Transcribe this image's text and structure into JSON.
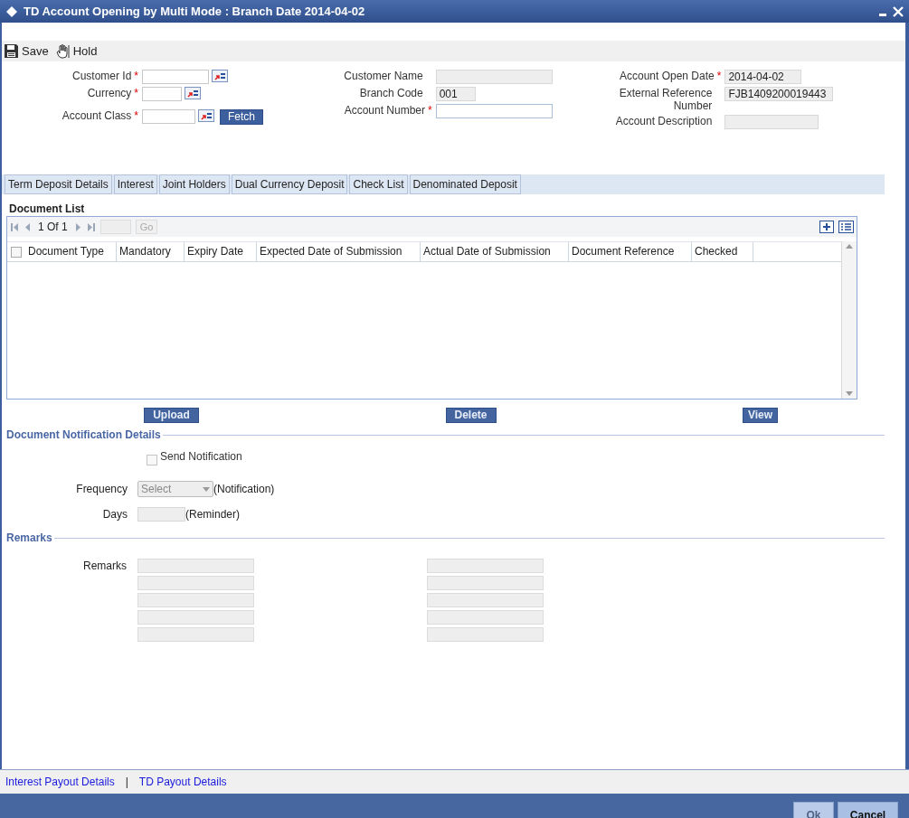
{
  "window": {
    "title": "TD Account Opening by Multi Mode : Branch Date 2014-04-02"
  },
  "toolbar": [
    {
      "kind": "save",
      "label": "Save"
    },
    {
      "kind": "hold",
      "label": "Hold"
    }
  ],
  "header_columns": [
    [
      {
        "label": "Customer Id",
        "required_mark": "*",
        "kind": "lov"
      },
      {
        "label": "Currency",
        "required_mark": "*",
        "kind": "lov"
      },
      {
        "label": "Account Class",
        "required_mark": "*",
        "kind": "lov",
        "action": "Fetch"
      }
    ],
    [
      {
        "label": "Customer Name",
        "kind": "readonly"
      },
      {
        "label": "Branch Code",
        "kind": "readonly",
        "value": "001"
      },
      {
        "label": "Account Number",
        "required_mark": "*",
        "kind": "text"
      }
    ],
    [
      {
        "label": "Account Open Date",
        "required_mark": "*",
        "kind": "readonly",
        "value": "2014-04-02"
      },
      {
        "label": "External Reference Number",
        "kind": "readonly",
        "value": "FJB1409200019443"
      },
      {
        "label": "Account Description",
        "kind": "readonly"
      }
    ]
  ],
  "tabs": [
    "Term Deposit Details",
    "Interest",
    "Joint Holders",
    "Dual Currency Deposit",
    "Check List",
    "Denominated Deposit"
  ],
  "document_list": {
    "title": "Document List",
    "pager": "1 Of 1",
    "go": "Go",
    "select_all_checked": false,
    "columns": [
      "Document Type",
      "Mandatory",
      "Expiry Date",
      "Expected Date of Submission",
      "Actual Date of Submission",
      "Document Reference",
      "Checked"
    ]
  },
  "list_buttons": [
    "Upload",
    "Delete",
    "View"
  ],
  "notification": {
    "title": "Document Notification Details",
    "send": {
      "label": "Send Notification",
      "checked": false,
      "disabled": true
    },
    "frequency": {
      "label": "Frequency",
      "placeholder": "Select",
      "suffix": "(Notification)"
    },
    "days": {
      "label": "Days",
      "suffix": "(Reminder)"
    }
  },
  "remarks": {
    "title": "Remarks",
    "label": "Remarks",
    "columns": [
      [
        {
          "kind": "readonly"
        },
        {
          "kind": "readonly"
        },
        {
          "kind": "readonly"
        },
        {
          "kind": "readonly"
        },
        {
          "kind": "readonly"
        }
      ],
      [
        {
          "kind": "readonly"
        },
        {
          "kind": "readonly"
        },
        {
          "kind": "readonly"
        },
        {
          "kind": "readonly"
        },
        {
          "kind": "readonly"
        }
      ]
    ]
  },
  "footer_links": [
    "Interest Payout Details",
    "|",
    "TD Payout Details"
  ],
  "footer_buttons": [
    {
      "label": "Ok",
      "disabled": true
    },
    {
      "label": "Cancel",
      "disabled": false
    }
  ]
}
